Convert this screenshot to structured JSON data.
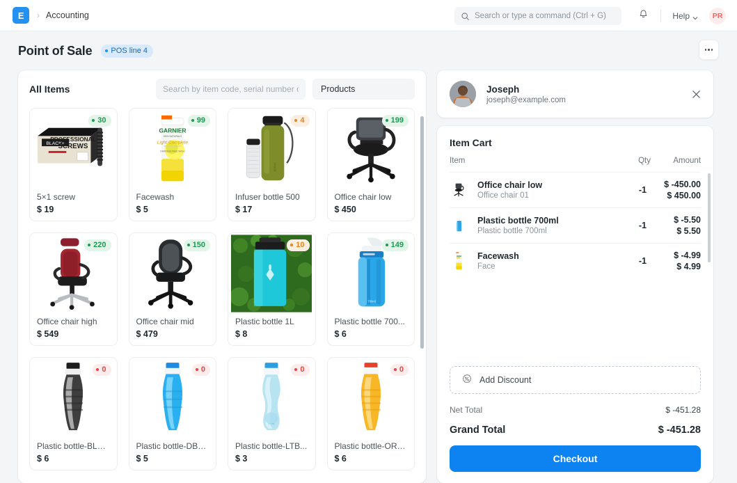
{
  "navbar": {
    "logo_letter": "E",
    "breadcrumb_sep": "›",
    "breadcrumb": "Accounting",
    "search_placeholder": "Search or type a command (Ctrl + G)",
    "search_value": "",
    "search_icon": "search-icon",
    "bell_icon": "bell-icon",
    "help_label": "Help",
    "help_chevron_icon": "chevron-down-icon",
    "avatar_initials": "PR"
  },
  "page": {
    "title": "Point of Sale",
    "badge": "POS line 4",
    "menu_icon": "ellipsis-icon"
  },
  "items_panel": {
    "title": "All Items",
    "search_placeholder": "Search by item code, serial number or bar",
    "search_value": "",
    "filter_value": "Products",
    "products": [
      {
        "name": "5×1 screw",
        "price": "$ 19",
        "stock": "30",
        "stock_level": "green",
        "image": "screw-box"
      },
      {
        "name": "Facewash",
        "price": "$ 5",
        "stock": "99",
        "stock_level": "green",
        "image": "facewash-tube"
      },
      {
        "name": "Infuser bottle 500",
        "price": "$ 17",
        "stock": "4",
        "stock_level": "orange",
        "image": "infuser-bottle"
      },
      {
        "name": "Office chair low",
        "price": "$ 450",
        "stock": "199",
        "stock_level": "green",
        "image": "office-chair-low"
      },
      {
        "name": "Office chair high",
        "price": "$ 549",
        "stock": "220",
        "stock_level": "green",
        "image": "office-chair-high"
      },
      {
        "name": "Office chair mid",
        "price": "$ 479",
        "stock": "150",
        "stock_level": "green",
        "image": "office-chair-mid"
      },
      {
        "name": "Plastic bottle 1L",
        "price": "$ 8",
        "stock": "10",
        "stock_level": "orange",
        "image": "hydro-bottle"
      },
      {
        "name": "Plastic bottle 700...",
        "price": "$ 6",
        "stock": "149",
        "stock_level": "green",
        "image": "sport-bottle"
      },
      {
        "name": "Plastic bottle-BLK...",
        "price": "$ 6",
        "stock": "0",
        "stock_level": "red",
        "image": "bottle-black"
      },
      {
        "name": "Plastic bottle-DBL...",
        "price": "$ 5",
        "stock": "0",
        "stock_level": "red",
        "image": "bottle-blue"
      },
      {
        "name": "Plastic bottle-LTB...",
        "price": "$ 3",
        "stock": "0",
        "stock_level": "red",
        "image": "bottle-lightblue"
      },
      {
        "name": "Plastic bottle-ORG...",
        "price": "$ 6",
        "stock": "0",
        "stock_level": "red",
        "image": "bottle-orange"
      }
    ]
  },
  "customer": {
    "name": "Joseph",
    "email": "joseph@example.com",
    "close_icon": "close-icon",
    "avatar_icon": "customer-avatar"
  },
  "cart": {
    "title": "Item Cart",
    "columns": {
      "item": "Item",
      "qty": "Qty",
      "amount": "Amount"
    },
    "rows": [
      {
        "name": "Office chair low",
        "sub": "Office chair 01",
        "qty": "-1",
        "amount_rate": "$ -450.00",
        "amount_total": "$ 450.00",
        "image": "office-chair-low"
      },
      {
        "name": "Plastic bottle 700ml",
        "sub": "Plastic bottle 700ml",
        "qty": "-1",
        "amount_rate": "$ -5.50",
        "amount_total": "$ 5.50",
        "image": "sport-bottle"
      },
      {
        "name": "Facewash",
        "sub": "Face",
        "qty": "-1",
        "amount_rate": "$ -4.99",
        "amount_total": "$ 4.99",
        "image": "facewash-tube"
      }
    ],
    "discount_label": "Add Discount",
    "discount_icon": "percent-badge-icon",
    "net_total_label": "Net Total",
    "net_total_value": "$ -451.28",
    "grand_total_label": "Grand Total",
    "grand_total_value": "$ -451.28",
    "checkout_label": "Checkout"
  },
  "colors": {
    "accent": "#2490ef",
    "checkout": "#0d83f2",
    "stock_green": "#1a9c52",
    "stock_orange": "#e8851c",
    "stock_red": "#e8453c",
    "badge_bg": "#d8eafc",
    "avatar_text": "#f56565"
  }
}
